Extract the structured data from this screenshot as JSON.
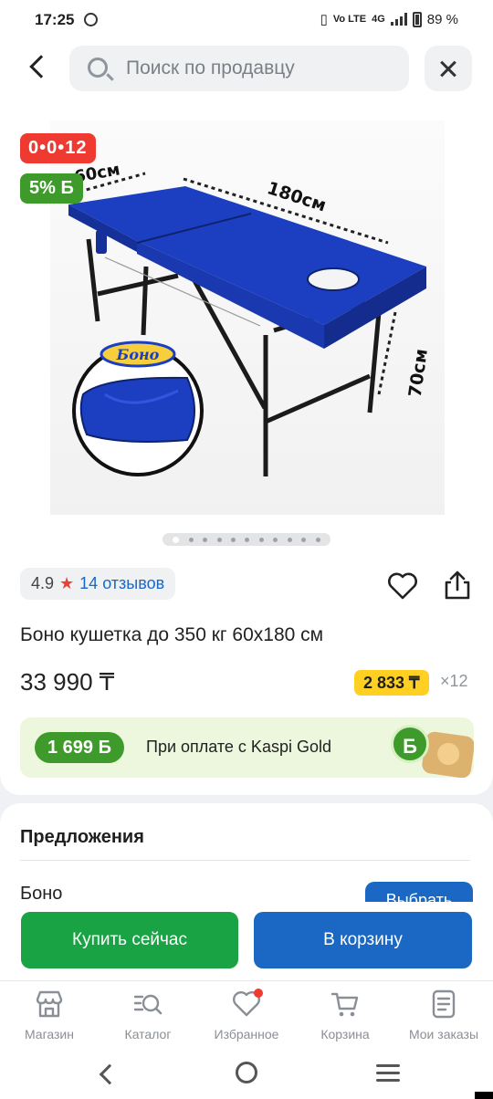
{
  "status_bar": {
    "time": "17:25",
    "network": "4G",
    "lte": "Vo LTE",
    "battery": "89 %"
  },
  "search": {
    "placeholder": "Поиск по продавцу"
  },
  "product": {
    "badge_installment": "0•0•12",
    "badge_bonus": "5% Б",
    "image_labels": {
      "width": "60см",
      "length": "180см",
      "height": "70см",
      "brand_logo": "Боно"
    },
    "gallery_pages": 11,
    "gallery_active": 0,
    "rating": "4.9",
    "reviews": "14 отзывов",
    "title": "Боно кушетка до 350 кг 60х180 см",
    "price": "33 990 ₸",
    "monthly_payment": "2 833 ₸",
    "monthly_term": "×12"
  },
  "kaspi_banner": {
    "bonus": "1 699 Б",
    "text": "При оплате с Kaspi Gold",
    "coin": "Б"
  },
  "offers": {
    "title": "Предложения",
    "seller": "Боно",
    "choose_label": "Выбрать"
  },
  "actions": {
    "buy_now": "Купить сейчас",
    "to_cart": "В корзину"
  },
  "bottom_nav": {
    "items": [
      {
        "label": "Магазин",
        "icon": "shop-icon"
      },
      {
        "label": "Каталог",
        "icon": "catalog-search-icon"
      },
      {
        "label": "Избранное",
        "icon": "heart-icon"
      },
      {
        "label": "Корзина",
        "icon": "cart-icon"
      },
      {
        "label": "Мои заказы",
        "icon": "orders-icon"
      }
    ]
  },
  "colors": {
    "primary_blue": "#1a67c4",
    "buy_green": "#1aa344",
    "bonus_green": "#3e9b2b",
    "installment_red": "#ef3a31",
    "monthly_yellow": "#ffd021",
    "couch_blue": "#1c3fc2"
  }
}
